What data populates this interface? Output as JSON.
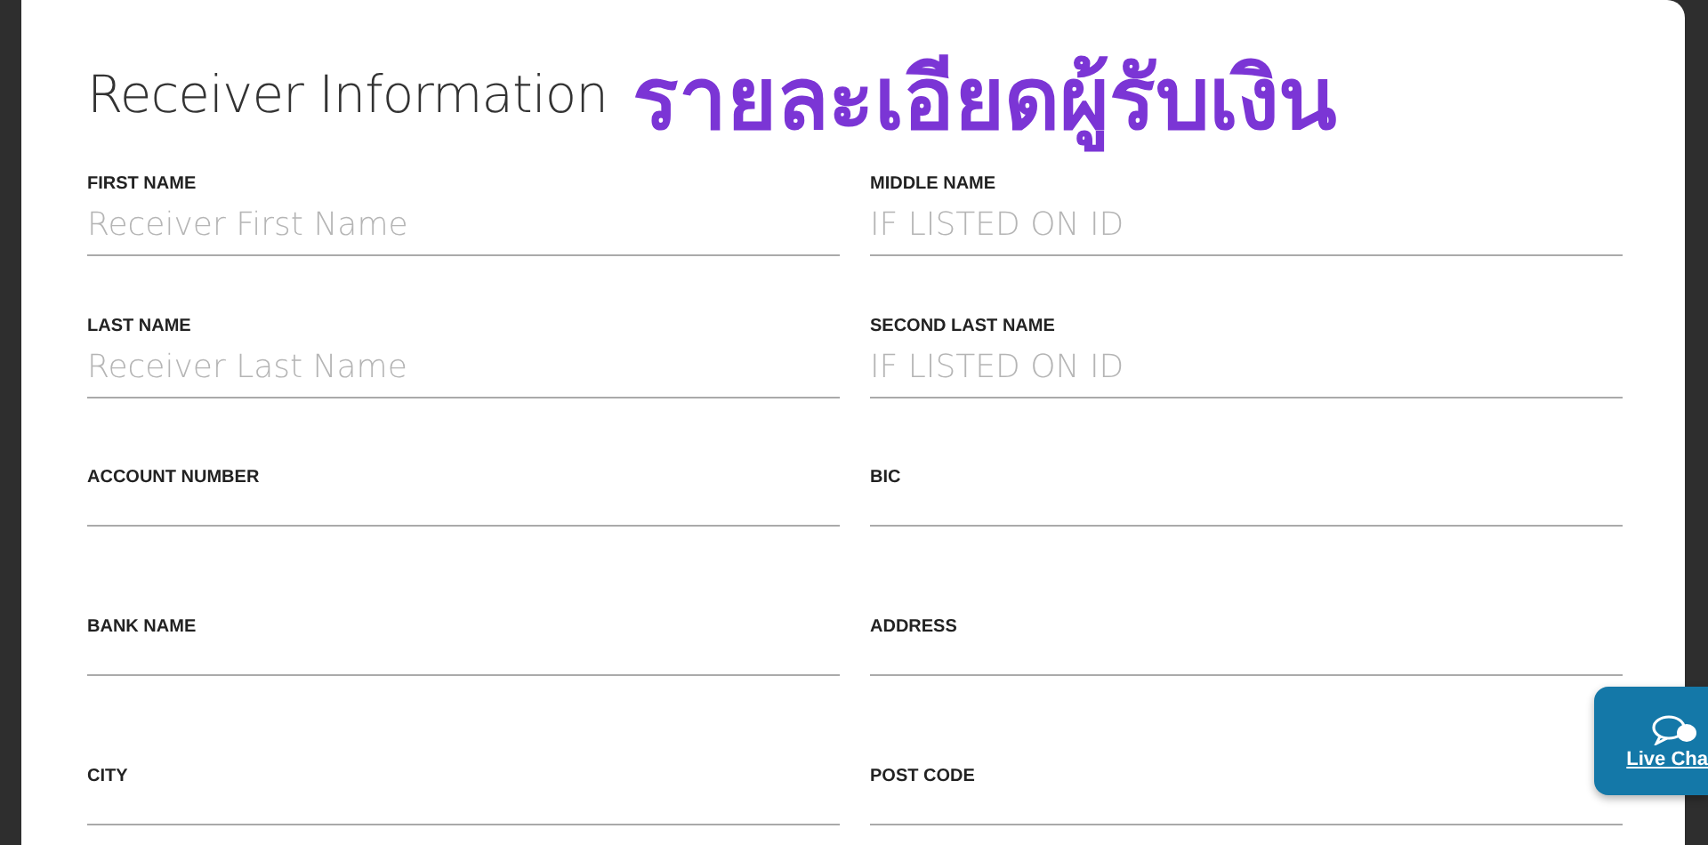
{
  "form": {
    "title": "Receiver Information",
    "annotation": "รายละเอียดผู้รับเงิน",
    "fields": [
      {
        "label": "FIRST NAME",
        "placeholder": "Receiver First Name"
      },
      {
        "label": "MIDDLE NAME",
        "placeholder": "IF LISTED ON ID"
      },
      {
        "label": "LAST NAME",
        "placeholder": "Receiver Last Name"
      },
      {
        "label": "SECOND LAST NAME",
        "placeholder": "IF LISTED ON ID"
      },
      {
        "label": "ACCOUNT NUMBER"
      },
      {
        "label": "BIC"
      },
      {
        "label": "BANK NAME"
      },
      {
        "label": "ADDRESS"
      },
      {
        "label": "CITY"
      },
      {
        "label": "POST CODE"
      }
    ]
  },
  "live_chat": {
    "label": "Live Cha"
  }
}
